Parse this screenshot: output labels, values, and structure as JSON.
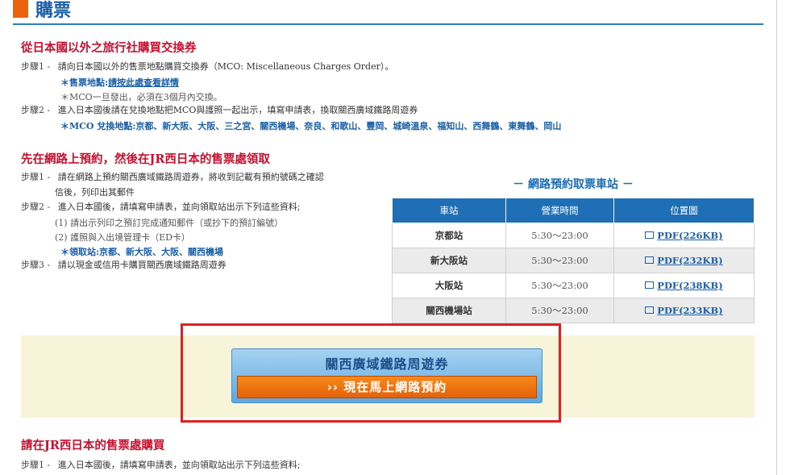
{
  "header": {
    "title": "購票"
  },
  "section1": {
    "heading": "從日本國以外之旅行社購買交換券",
    "step1_label": "步驟1 -",
    "step1_text": "請向日本國以外的售票地點購買交換券（MCO: Miscellaneous Charges Order）。",
    "sales_point_label": "＊售票地點:",
    "sales_point_link": "請按此處查看詳情",
    "mco_note": "＊MCO一旦發出，必須在3個月內交換。",
    "step2_label": "步驟2 -",
    "step2_text": "進入日本國後請在兌換地點把MCO與護照一起出示，填寫申請表，換取關西廣域鐵路周遊券",
    "exchange_points": "＊MCO 兌換地點:京都、新大阪、大阪、三之宮、關西機場、奈良、和歌山、豐岡、城崎溫泉、福知山、西舞鶴、東舞鶴、岡山"
  },
  "section2": {
    "heading": "先在網路上預約，然後在JR西日本的售票處領取",
    "step1_label": "步驟1 -",
    "step1_text_a": "請在網路上預約關西廣域鐵路周遊券，將收到記載有預約號碼之確認",
    "step1_text_b": "信後，列印出其郵件",
    "step2_label": "步驟2 -",
    "step2_text": "進入日本國後，請填寫申請表，並向領取站出示下列這些資料;",
    "step2_item1": "(1) 請出示列印之預訂完成通知郵件（或抄下的預訂編號）",
    "step2_item2": "(2) 護照與入出境管理卡（ED卡）",
    "pickup_stations": "＊領取站:京都、新大阪、大阪、關西機場",
    "step3_label": "步驟3 -",
    "step3_text": "請以現金或信用卡購買關西廣域鐵路周遊券"
  },
  "station_table": {
    "title": "－ 網路預約取票車站 －",
    "headers": [
      "車站",
      "營業時間",
      "位置圖"
    ],
    "rows": [
      {
        "station": "京都站",
        "hours": "5:30～23:00",
        "map": "PDF(226KB)"
      },
      {
        "station": "新大阪站",
        "hours": "5:30～23:00",
        "map": "PDF(232KB)"
      },
      {
        "station": "大阪站",
        "hours": "5:30～23:00",
        "map": "PDF(238KB)"
      },
      {
        "station": "關西機場站",
        "hours": "5:30～23:00",
        "map": "PDF(233KB)"
      }
    ]
  },
  "promo": {
    "title": "關西廣域鐵路周遊券",
    "cta": "›› 現在馬上網路預約"
  },
  "section3": {
    "heading": "請在JR西日本的售票處購買",
    "step1_label": "步驟1 -",
    "step1_text": "進入日本國後，請填寫申請表，並向領取站出示下列這些資料;"
  },
  "colors": {
    "accent_orange": "#e8650e",
    "heading_red": "#c8102e",
    "link_blue": "#1a5fa8",
    "table_header": "#1e6fb5",
    "highlight_frame": "#e0201f"
  }
}
